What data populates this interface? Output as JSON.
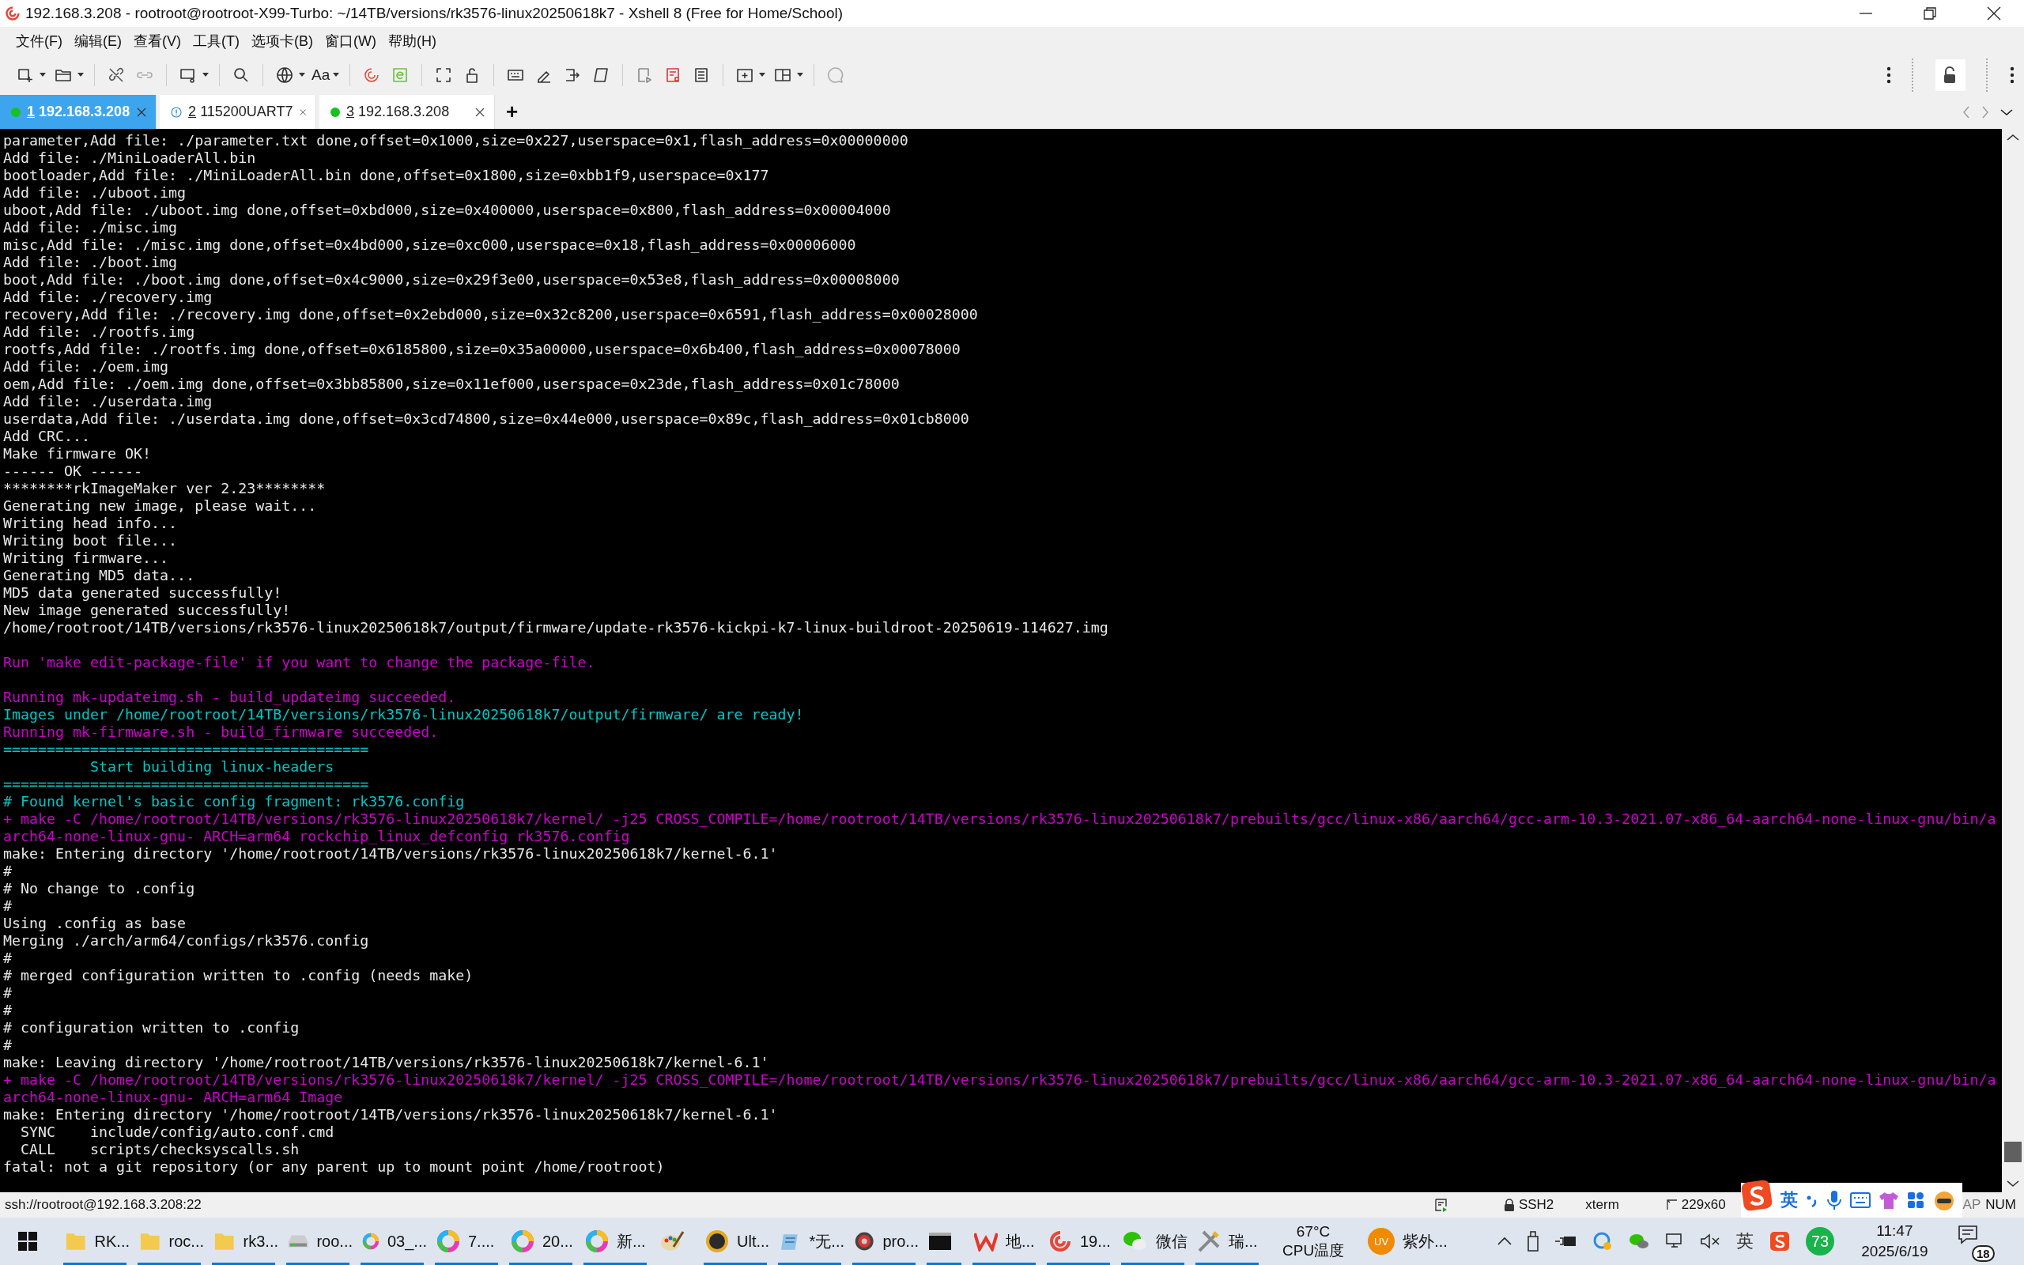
{
  "window": {
    "title": "192.168.3.208 - rootroot@rootroot-X99-Turbo: ~/14TB/versions/rk3576-linux20250618k7 - Xshell 8 (Free for Home/School)"
  },
  "menu": [
    "文件(F)",
    "编辑(E)",
    "查看(V)",
    "工具(T)",
    "选项卡(B)",
    "窗口(W)",
    "帮助(H)"
  ],
  "toolbar": {
    "font_label": "Aa"
  },
  "tabs": [
    {
      "number": "1",
      "label": "192.168.3.208",
      "kind": "connected",
      "selected": true
    },
    {
      "number": "2",
      "label": "115200UART7",
      "kind": "warning",
      "selected": false
    },
    {
      "number": "3",
      "label": "192.168.3.208",
      "kind": "connected",
      "selected": false
    }
  ],
  "add_tab": "+",
  "terminal": [
    {
      "kind": "normal",
      "text": "parameter,Add file: ./parameter.txt done,offset=0x1000,size=0x227,userspace=0x1,flash_address=0x00000000"
    },
    {
      "kind": "normal",
      "text": "Add file: ./MiniLoaderAll.bin"
    },
    {
      "kind": "normal",
      "text": "bootloader,Add file: ./MiniLoaderAll.bin done,offset=0x1800,size=0xbb1f9,userspace=0x177"
    },
    {
      "kind": "normal",
      "text": "Add file: ./uboot.img"
    },
    {
      "kind": "normal",
      "text": "uboot,Add file: ./uboot.img done,offset=0xbd000,size=0x400000,userspace=0x800,flash_address=0x00004000"
    },
    {
      "kind": "normal",
      "text": "Add file: ./misc.img"
    },
    {
      "kind": "normal",
      "text": "misc,Add file: ./misc.img done,offset=0x4bd000,size=0xc000,userspace=0x18,flash_address=0x00006000"
    },
    {
      "kind": "normal",
      "text": "Add file: ./boot.img"
    },
    {
      "kind": "normal",
      "text": "boot,Add file: ./boot.img done,offset=0x4c9000,size=0x29f3e00,userspace=0x53e8,flash_address=0x00008000"
    },
    {
      "kind": "normal",
      "text": "Add file: ./recovery.img"
    },
    {
      "kind": "normal",
      "text": "recovery,Add file: ./recovery.img done,offset=0x2ebd000,size=0x32c8200,userspace=0x6591,flash_address=0x00028000"
    },
    {
      "kind": "normal",
      "text": "Add file: ./rootfs.img"
    },
    {
      "kind": "normal",
      "text": "rootfs,Add file: ./rootfs.img done,offset=0x6185800,size=0x35a00000,userspace=0x6b400,flash_address=0x00078000"
    },
    {
      "kind": "normal",
      "text": "Add file: ./oem.img"
    },
    {
      "kind": "normal",
      "text": "oem,Add file: ./oem.img done,offset=0x3bb85800,size=0x11ef000,userspace=0x23de,flash_address=0x01c78000"
    },
    {
      "kind": "normal",
      "text": "Add file: ./userdata.img"
    },
    {
      "kind": "normal",
      "text": "userdata,Add file: ./userdata.img done,offset=0x3cd74800,size=0x44e000,userspace=0x89c,flash_address=0x01cb8000"
    },
    {
      "kind": "normal",
      "text": "Add CRC..."
    },
    {
      "kind": "normal",
      "text": "Make firmware OK!"
    },
    {
      "kind": "normal",
      "text": "------ OK ------"
    },
    {
      "kind": "normal",
      "text": "********rkImageMaker ver 2.23********"
    },
    {
      "kind": "normal",
      "text": "Generating new image, please wait..."
    },
    {
      "kind": "normal",
      "text": "Writing head info..."
    },
    {
      "kind": "normal",
      "text": "Writing boot file..."
    },
    {
      "kind": "normal",
      "text": "Writing firmware..."
    },
    {
      "kind": "normal",
      "text": "Generating MD5 data..."
    },
    {
      "kind": "normal",
      "text": "MD5 data generated successfully!"
    },
    {
      "kind": "normal",
      "text": "New image generated successfully!"
    },
    {
      "kind": "normal",
      "text": "/home/rootroot/14TB/versions/rk3576-linux20250618k7/output/firmware/update-rk3576-kickpi-k7-linux-buildroot-20250619-114627.img"
    },
    {
      "kind": "blank"
    },
    {
      "kind": "magenta",
      "text": "Run 'make edit-package-file' if you want to change the package-file."
    },
    {
      "kind": "blank"
    },
    {
      "kind": "magenta",
      "text": "Running mk-updateimg.sh - build_updateimg succeeded."
    },
    {
      "kind": "cyan",
      "text": "Images under /home/rootroot/14TB/versions/rk3576-linux20250618k7/output/firmware/ are ready!"
    },
    {
      "kind": "magenta",
      "text": "Running mk-firmware.sh - build_firmware succeeded."
    },
    {
      "kind": "cyan",
      "text": "=========================================="
    },
    {
      "kind": "cyan",
      "text": "          Start building linux-headers"
    },
    {
      "kind": "cyan",
      "text": "=========================================="
    },
    {
      "kind": "cyan",
      "text": "# Found kernel's basic config fragment: rk3576.config"
    },
    {
      "kind": "magenta",
      "text": "+ make -C /home/rootroot/14TB/versions/rk3576-linux20250618k7/kernel/ -j25 CROSS_COMPILE=/home/rootroot/14TB/versions/rk3576-linux20250618k7/prebuilts/gcc/linux-x86/aarch64/gcc-arm-10.3-2021.07-x86_64-aarch64-none-linux-gnu/bin/a"
    },
    {
      "kind": "magenta",
      "text": "arch64-none-linux-gnu- ARCH=arm64 rockchip_linux_defconfig rk3576.config"
    },
    {
      "kind": "normal",
      "text": "make: Entering directory '/home/rootroot/14TB/versions/rk3576-linux20250618k7/kernel-6.1'"
    },
    {
      "kind": "normal",
      "text": "#"
    },
    {
      "kind": "normal",
      "text": "# No change to .config"
    },
    {
      "kind": "normal",
      "text": "#"
    },
    {
      "kind": "normal",
      "text": "Using .config as base"
    },
    {
      "kind": "normal",
      "text": "Merging ./arch/arm64/configs/rk3576.config"
    },
    {
      "kind": "normal",
      "text": "#"
    },
    {
      "kind": "normal",
      "text": "# merged configuration written to .config (needs make)"
    },
    {
      "kind": "normal",
      "text": "#"
    },
    {
      "kind": "normal",
      "text": "#"
    },
    {
      "kind": "normal",
      "text": "# configuration written to .config"
    },
    {
      "kind": "normal",
      "text": "#"
    },
    {
      "kind": "normal",
      "text": "make: Leaving directory '/home/rootroot/14TB/versions/rk3576-linux20250618k7/kernel-6.1'"
    },
    {
      "kind": "magenta",
      "text": "+ make -C /home/rootroot/14TB/versions/rk3576-linux20250618k7/kernel/ -j25 CROSS_COMPILE=/home/rootroot/14TB/versions/rk3576-linux20250618k7/prebuilts/gcc/linux-x86/aarch64/gcc-arm-10.3-2021.07-x86_64-aarch64-none-linux-gnu/bin/a"
    },
    {
      "kind": "magenta",
      "text": "arch64-none-linux-gnu- ARCH=arm64 Image"
    },
    {
      "kind": "normal",
      "text": "make: Entering directory '/home/rootroot/14TB/versions/rk3576-linux20250618k7/kernel-6.1'"
    },
    {
      "kind": "normal",
      "text": "  SYNC    include/config/auto.conf.cmd"
    },
    {
      "kind": "normal",
      "text": "  CALL    scripts/checksyscalls.sh"
    },
    {
      "kind": "normal",
      "text": "fatal: not a git repository (or any parent up to mount point /home/rootroot)"
    }
  ],
  "status_bar": {
    "address": "ssh://rootroot@192.168.3.208:22",
    "protocol": "SSH2",
    "terminal_type": "xterm",
    "size": "229x60",
    "caps": "AP",
    "num": "NUM"
  },
  "ime_toolbar": {
    "language": "英"
  },
  "taskbar": {
    "items": [
      {
        "kind": "folder",
        "label": "RK...",
        "running": true
      },
      {
        "kind": "folder",
        "label": "roc...",
        "running": true
      },
      {
        "kind": "folder",
        "label": "rk3...",
        "running": true
      },
      {
        "kind": "drive",
        "label": "roo...",
        "running": true
      },
      {
        "kind": "ring",
        "label": "03_...",
        "running": true
      },
      {
        "kind": "ring",
        "label": "7....",
        "running": true
      },
      {
        "kind": "ring",
        "label": "20...",
        "running": true
      },
      {
        "kind": "ring",
        "label": "新...",
        "running": true
      },
      {
        "kind": "paint",
        "running": false
      },
      {
        "kind": "ue",
        "label": "Ult...",
        "running": true
      },
      {
        "kind": "notepad",
        "label": "*无...",
        "running": true
      },
      {
        "kind": "disc",
        "label": "pro...",
        "running": true
      },
      {
        "kind": "console",
        "running": true
      },
      {
        "kind": "wps",
        "label": "地...",
        "running": true
      },
      {
        "kind": "spiral",
        "label": "19...",
        "running": true
      },
      {
        "kind": "chat",
        "label": "微信",
        "running": true
      },
      {
        "kind": "tools",
        "label": "瑞...",
        "running": true
      }
    ],
    "temperature": "67°C",
    "temperature_label": "CPU温度",
    "uv_badge": "UV",
    "uv_label": "紫外...",
    "ime": "英",
    "battery_badge": "73",
    "time": "11:47",
    "date": "2025/6/19",
    "notifications": "18"
  }
}
